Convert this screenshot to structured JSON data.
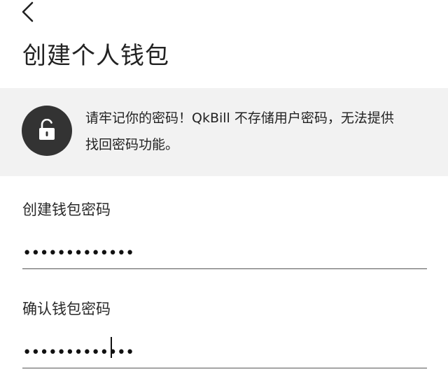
{
  "header": {
    "back_icon": "chevron-left-icon",
    "title": "创建个人钱包"
  },
  "notice": {
    "icon": "unlock-icon",
    "line1": "请牢记你的密码！QkBill 不存储用户密码，无法提供",
    "line2": "找回密码功能。",
    "bg_color": "#f2f2f2",
    "icon_bg_color": "#333333"
  },
  "form": {
    "create_password": {
      "label": "创建钱包密码",
      "value": "•••••••••••••"
    },
    "confirm_password": {
      "label": "确认钱包密码",
      "value": "•••••••••••••"
    }
  }
}
